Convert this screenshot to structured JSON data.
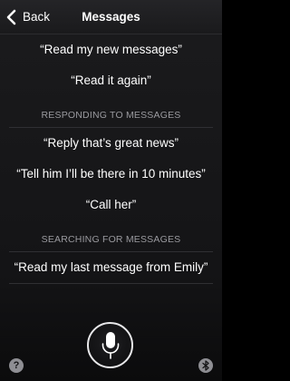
{
  "navbar": {
    "back_label": "Back",
    "title": "Messages"
  },
  "sections": [
    {
      "header": "",
      "phrases": [
        "“Read my new messages”",
        "“Read it again”"
      ]
    },
    {
      "header": "RESPONDING TO MESSAGES",
      "phrases": [
        "“Reply that’s great news”",
        "“Tell him I’ll be there in 10 minutes”",
        "“Call her”"
      ]
    },
    {
      "header": "SEARCHING FOR MESSAGES",
      "phrases": [
        "“Read my last message from Emily”"
      ]
    }
  ],
  "bottom": {
    "mic_icon": "microphone-icon",
    "help_icon": "question-mark-icon",
    "help_glyph": "?",
    "bluetooth_icon": "bluetooth-icon"
  },
  "colors": {
    "background": "#141416",
    "header_text": "#9a9a9f",
    "divider": "#2f2f33"
  }
}
